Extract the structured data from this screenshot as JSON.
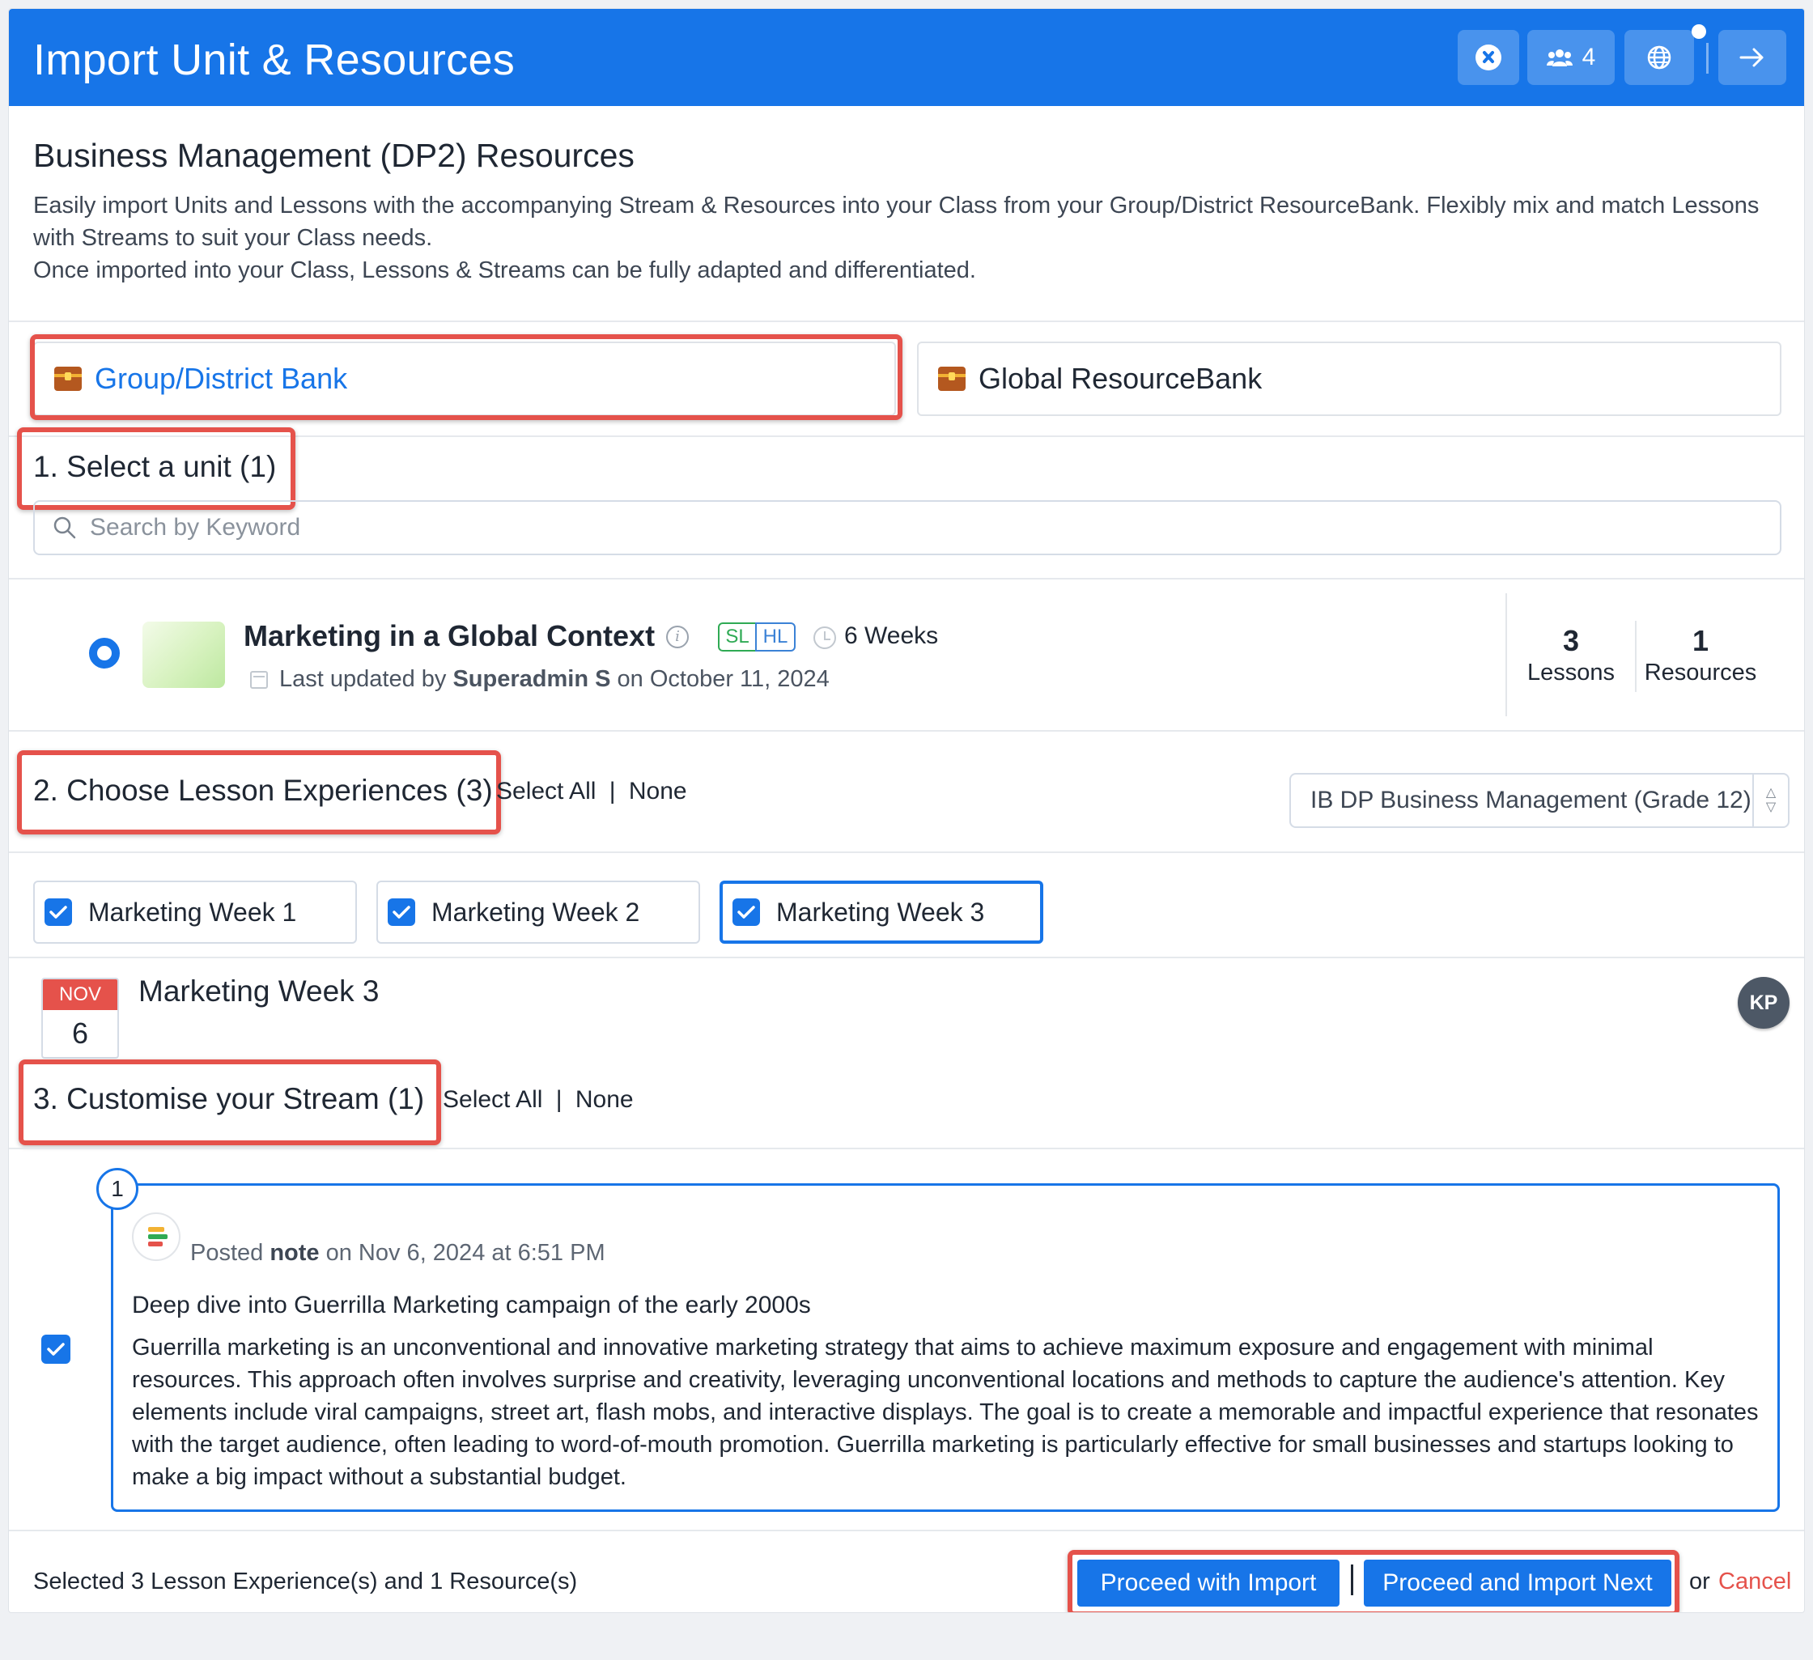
{
  "header": {
    "title": "Import Unit & Resources",
    "buttons": [
      {
        "icon": "chat-icon"
      },
      {
        "icon": "people-icon",
        "count": "4"
      },
      {
        "icon": "globe-icon"
      },
      {
        "icon": "arrow-right-icon"
      }
    ]
  },
  "intro": {
    "title": "Business Management (DP2) Resources",
    "line1": "Easily import Units and Lessons with the accompanying Stream & Resources into your Class from your Group/District ResourceBank. Flexibly mix and match Lessons with Streams to suit your Class needs.",
    "line2": "Once imported into your Class, Lessons & Streams can be fully adapted and differentiated."
  },
  "banks": {
    "group": "Group/District Bank",
    "global": "Global ResourceBank"
  },
  "step1": {
    "title": "1. Select a unit (1)",
    "search_placeholder": "Search by Keyword"
  },
  "unit": {
    "title": "Marketing in a Global Context",
    "levels": [
      "SL",
      "HL"
    ],
    "duration": "6 Weeks",
    "updated_prefix": "Last updated by ",
    "updated_by": "Superadmin S",
    "updated_suffix": " on October 11, 2024",
    "lessons_count": "3",
    "lessons_label": "Lessons",
    "resources_count": "1",
    "resources_label": "Resources"
  },
  "step2": {
    "title": "2. Choose Lesson Experiences (3)",
    "select_all": "Select All",
    "none": "None",
    "separator": "|",
    "class_select": "IB DP Business Management (Grade 12)",
    "lessons": [
      "Marketing Week 1",
      "Marketing Week 2",
      "Marketing Week 3"
    ]
  },
  "lesson_detail": {
    "month": "NOV",
    "day": "6",
    "title": "Marketing Week 3",
    "avatar": "KP"
  },
  "step3": {
    "title": "3. Customise your Stream (1)",
    "select_all": "Select All",
    "none": "None",
    "separator": "|"
  },
  "stream_item": {
    "number": "1",
    "posted_prefix": "Posted ",
    "posted_type": "note",
    "posted_suffix": " on Nov 6, 2024 at 6:51 PM",
    "title": "Deep dive into Guerrilla Marketing campaign of the early 2000s",
    "body": "Guerrilla marketing is an unconventional and innovative marketing strategy that aims to achieve maximum exposure and engagement with minimal resources. This approach often involves surprise and creativity, leveraging unconventional locations and methods to capture the audience's attention. Key elements include viral campaigns, street art, flash mobs, and interactive displays. The goal is to create a memorable and impactful experience that resonates with the target audience, often leading to word-of-mouth promotion. Guerrilla marketing is particularly effective for small businesses and startups looking to make a big impact without a substantial budget."
  },
  "footer": {
    "summary": "Selected 3 Lesson Experience(s) and 1 Resource(s)",
    "proceed": "Proceed with Import",
    "separator": "|",
    "proceed_next": "Proceed and Import Next",
    "or": "or",
    "cancel": "Cancel"
  },
  "colors": {
    "primary": "#1775e8",
    "highlight": "#e5524b",
    "sl": "#2faa54",
    "hl": "#3b82d6"
  }
}
